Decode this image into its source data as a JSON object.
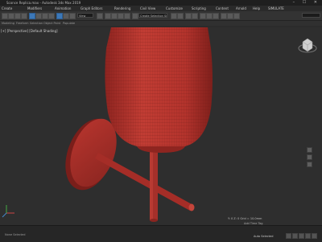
{
  "window": {
    "title": "Sconce Replica.max - Autodesk 3ds Max 2019",
    "controls": "–  ☐  ✕"
  },
  "menu": [
    "Create",
    "Modifiers",
    "Animation",
    "Graph Editors",
    "Rendering",
    "Civil View",
    "Customize",
    "Scripting",
    "Content",
    "Arnold",
    "Help",
    "SIMULATE"
  ],
  "toolbar": {
    "view_dropdown": "View",
    "selection_set": "Create Selection Set",
    "search_placeholder": ""
  },
  "ribbon": {
    "items": [
      "Modeling",
      "Freeform",
      "Selection",
      "Object Paint",
      "Populate"
    ]
  },
  "viewport": {
    "label": "[+] [Perspective] [Default Shading]",
    "object_color": "#b8352e",
    "background": "#2e2e2e"
  },
  "status": {
    "selection": "None Selected",
    "coords": "Y: 0   Z: 0   Grid = 10.0mm",
    "add_tag": "Add Time Tag",
    "mode": "Auto  Selected"
  }
}
